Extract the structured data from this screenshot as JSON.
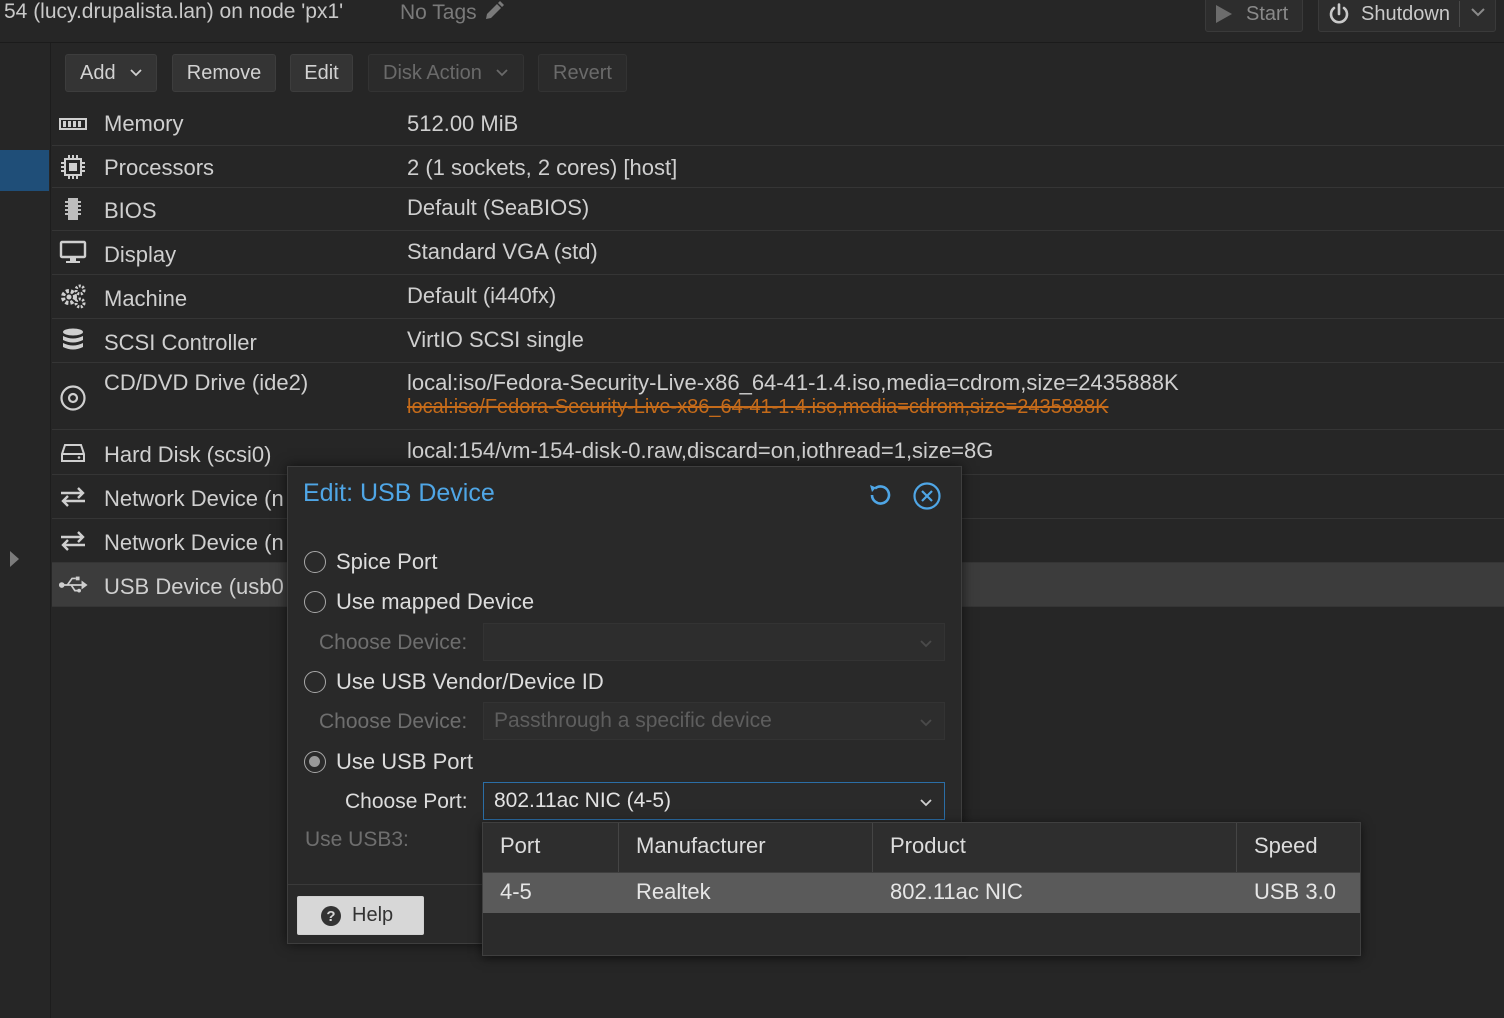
{
  "header": {
    "vm_title": "54 (lucy.drupalista.lan) on node 'px1'",
    "tags_label": "No Tags",
    "start_label": "Start",
    "shutdown_label": "Shutdown"
  },
  "toolbar": {
    "add_label": "Add",
    "remove_label": "Remove",
    "edit_label": "Edit",
    "disk_action_label": "Disk Action",
    "revert_label": "Revert"
  },
  "hardware": [
    {
      "icon": "memory-icon",
      "name": "Memory",
      "value": "512.00 MiB"
    },
    {
      "icon": "processor-icon",
      "name": "Processors",
      "value": "2 (1 sockets, 2 cores) [host]"
    },
    {
      "icon": "bios-icon",
      "name": "BIOS",
      "value": "Default (SeaBIOS)"
    },
    {
      "icon": "display-icon",
      "name": "Display",
      "value": "Standard VGA (std)"
    },
    {
      "icon": "gears-icon",
      "name": "Machine",
      "value": "Default (i440fx)"
    },
    {
      "icon": "database-icon",
      "name": "SCSI Controller",
      "value": "VirtIO SCSI single"
    },
    {
      "icon": "cdrom-icon",
      "name": "CD/DVD Drive (ide2)",
      "value": "local:iso/Fedora-Security-Live-x86_64-41-1.4.iso,media=cdrom,size=2435888K",
      "pending_value": "local:iso/Fedora-Security-Live-x86_64-41-1.4.iso,media=cdrom,size=2435888K"
    },
    {
      "icon": "hard-disk-icon",
      "name": "Hard Disk (scsi0)",
      "value": "local:154/vm-154-disk-0.raw,discard=on,iothread=1,size=8G"
    },
    {
      "icon": "network-icon",
      "name": "Network Device (n",
      "value": ""
    },
    {
      "icon": "network-icon",
      "name": "Network Device (n",
      "value": ""
    },
    {
      "icon": "usb-icon",
      "name": "USB Device (usb0",
      "value": ""
    }
  ],
  "dialog": {
    "title": "Edit: USB Device",
    "options": {
      "spice": "Spice Port",
      "mapped": "Use mapped Device",
      "vendor": "Use USB Vendor/Device ID",
      "port": "Use USB Port"
    },
    "selected_option": "Use USB Port",
    "mapped_label": "Choose Device:",
    "mapped_value": "",
    "vendor_label": "Choose Device:",
    "vendor_placeholder": "Passthrough a specific device",
    "port_label": "Choose Port:",
    "port_value": "802.11ac NIC (4-5)",
    "usb3_label": "Use USB3:",
    "help_label": "Help"
  },
  "port_picker": {
    "columns": [
      "Port",
      "Manufacturer",
      "Product",
      "Speed"
    ],
    "rows": [
      {
        "port": "4-5",
        "manufacturer": "Realtek",
        "product": "802.11ac NIC",
        "speed": "USB 3.0"
      }
    ]
  },
  "colors": {
    "accent": "#4fa6e6",
    "pending_change": "#c56b1a",
    "selection": "#1f4e78"
  }
}
